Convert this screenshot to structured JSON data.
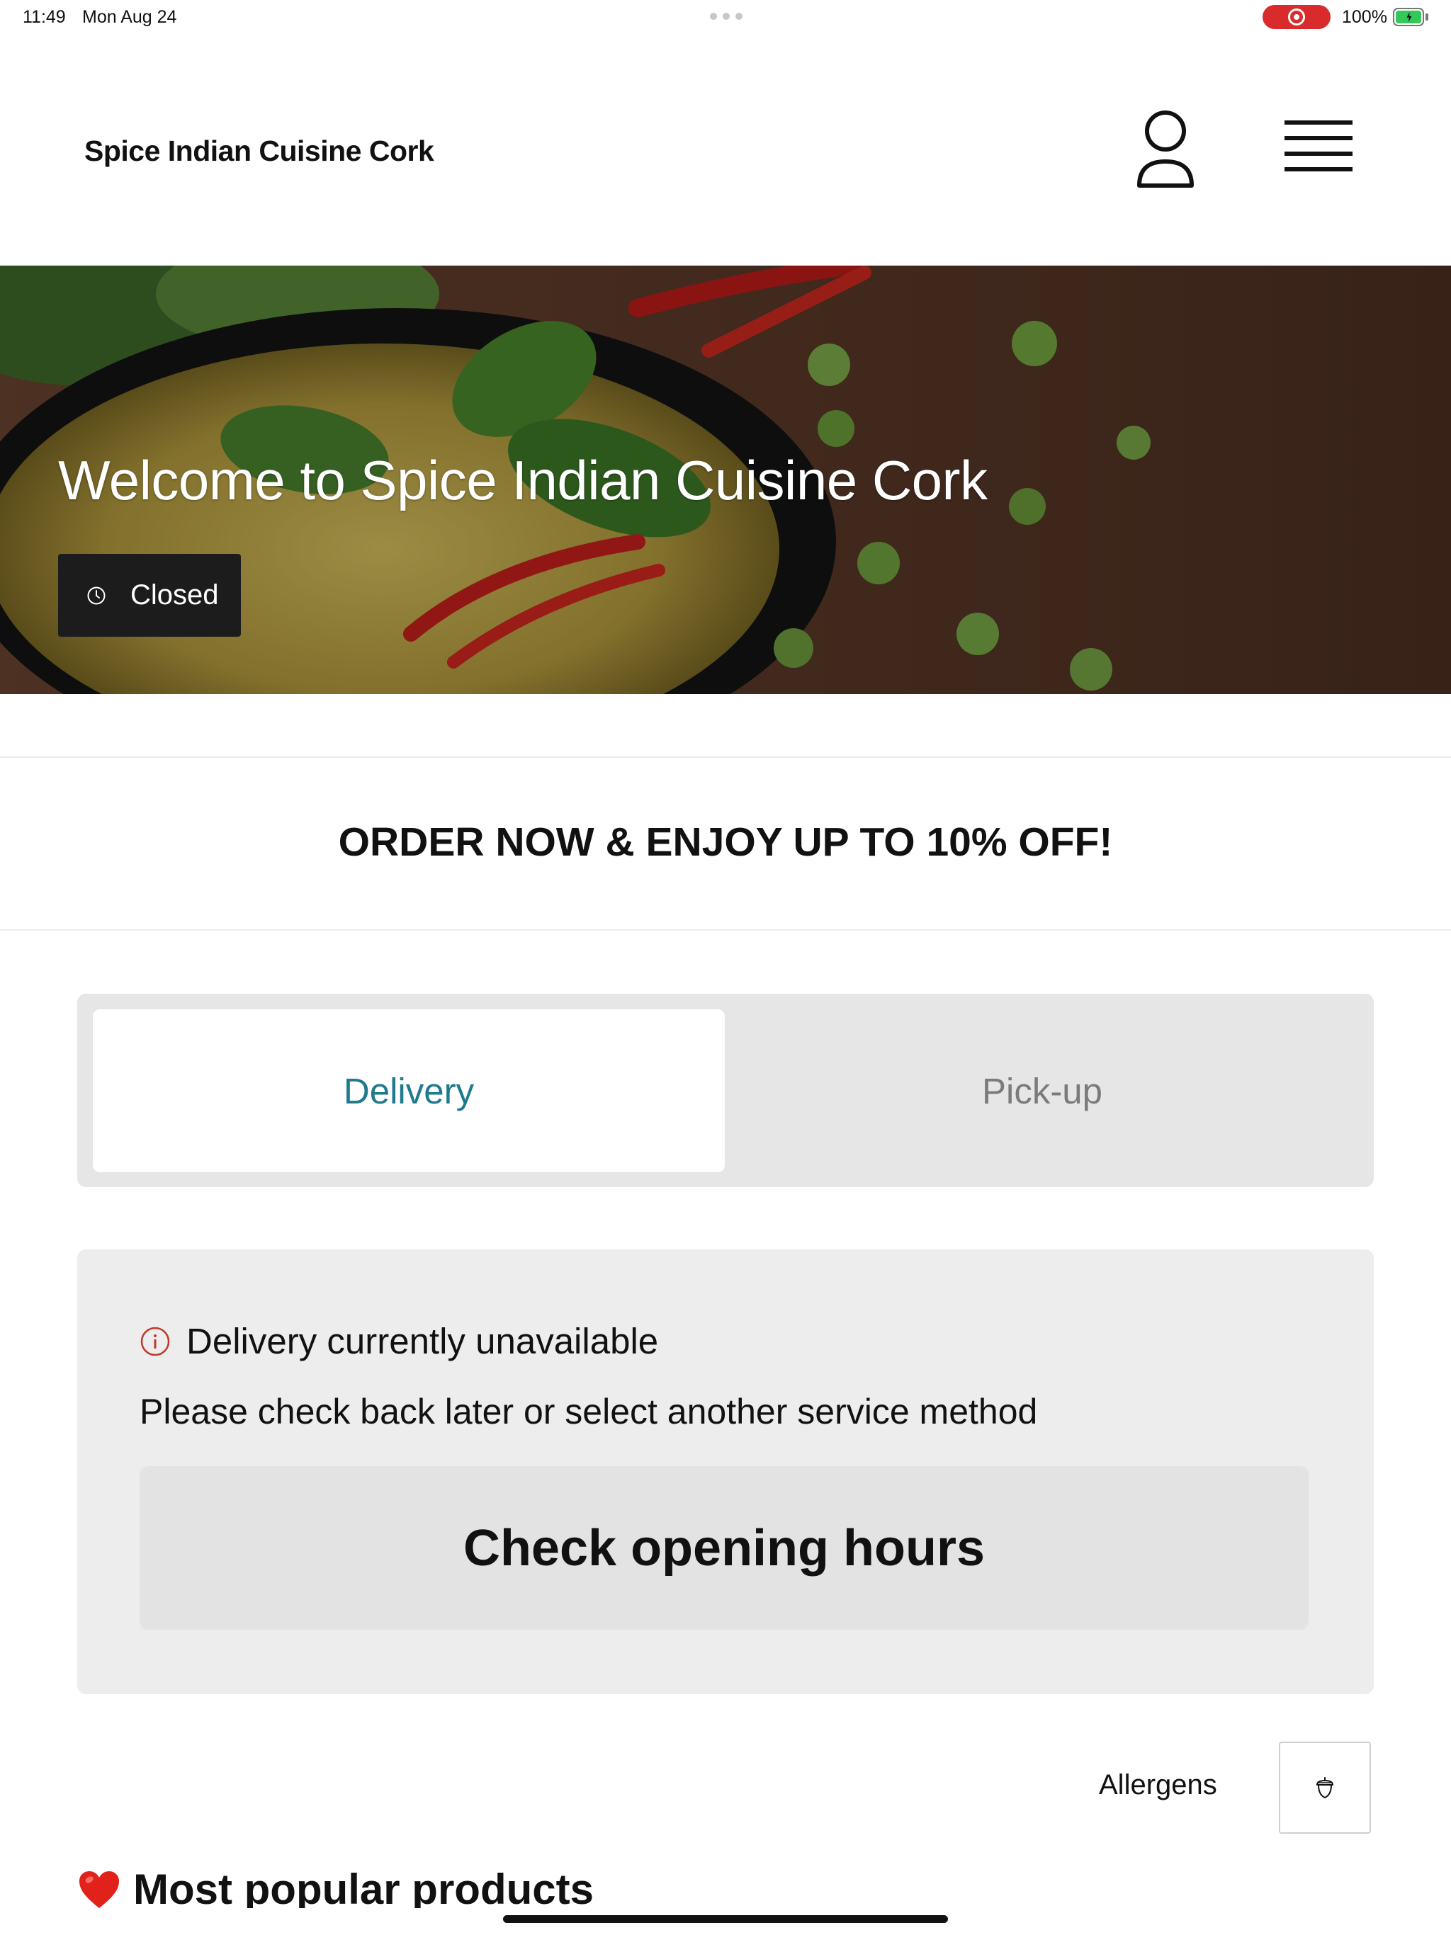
{
  "status_bar": {
    "time": "11:49",
    "date": "Mon Aug 24",
    "battery": "100%"
  },
  "header": {
    "brand": "Spice Indian Cuisine Cork"
  },
  "hero": {
    "title": "Welcome to Spice Indian Cuisine Cork",
    "status_badge": "Closed"
  },
  "promo": {
    "text": "ORDER NOW & ENJOY UP TO 10% OFF!"
  },
  "service": {
    "options": [
      "Delivery",
      "Pick-up"
    ],
    "selected": "Delivery"
  },
  "notice": {
    "title": "Delivery currently unavailable",
    "subtitle": "Please check back later or select another service method",
    "button": "Check opening hours"
  },
  "allergens": {
    "label": "Allergens"
  },
  "sections": {
    "popular": "Most popular products"
  },
  "colors": {
    "accent_teal": "#1e7a8c",
    "closed_badge_bg": "#1c1c1c",
    "info_icon": "#c0392b",
    "record_pill": "#d92b2b",
    "battery": "#34c759"
  },
  "icons": {
    "account": "user-icon",
    "menu": "hamburger-icon",
    "clock": "clock-icon",
    "info": "info-icon",
    "allergens": "acorn-icon",
    "heart": "heart-icon"
  }
}
